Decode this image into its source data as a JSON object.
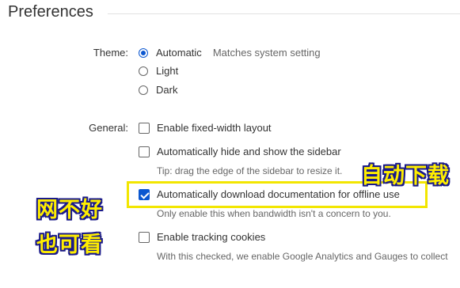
{
  "page": {
    "title": "Preferences"
  },
  "theme": {
    "label": "Theme:",
    "options": [
      {
        "label": "Automatic",
        "note": "Matches system setting",
        "selected": true
      },
      {
        "label": "Light",
        "selected": false
      },
      {
        "label": "Dark",
        "selected": false
      }
    ]
  },
  "general": {
    "label": "General:",
    "items": [
      {
        "label": "Enable fixed-width layout",
        "checked": false
      },
      {
        "label": "Automatically hide and show the sidebar",
        "checked": false,
        "tip": "Tip: drag the edge of the sidebar to resize it."
      },
      {
        "label": "Automatically download documentation for offline use",
        "checked": true,
        "tip": "Only enable this when bandwidth isn't a concern to you."
      },
      {
        "label": "Enable tracking cookies",
        "checked": false,
        "tip": "With this checked, we enable Google Analytics and Gauges to collect"
      }
    ]
  },
  "annotations": {
    "auto_download": "自动下载",
    "line1": "网不好",
    "line2": "也可看",
    "highlight_color": "#f2e600",
    "text_color": "#ffee00"
  },
  "colors": {
    "accent": "#0b57d0"
  }
}
